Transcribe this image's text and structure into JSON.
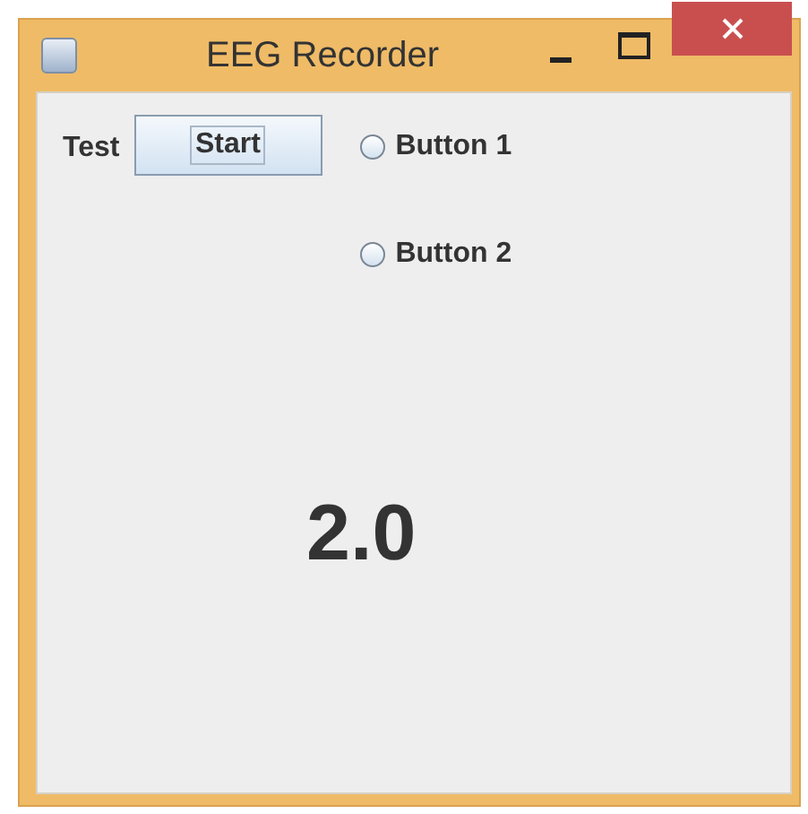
{
  "window": {
    "title": "EEG Recorder"
  },
  "test_label": "Test",
  "start_button": {
    "label": "Start",
    "focused": true
  },
  "radios": [
    {
      "label": "Button 1",
      "selected": false
    },
    {
      "label": "Button 2",
      "selected": false
    }
  ],
  "reading": "2.0"
}
